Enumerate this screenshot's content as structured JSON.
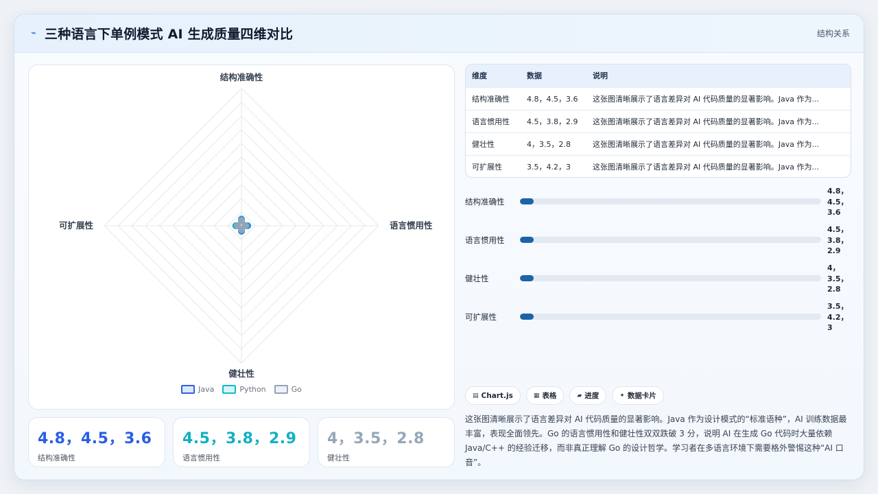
{
  "header": {
    "title": "三种语言下单例模式 AI 生成质量四维对比",
    "icon": "trend-icon",
    "tag": "结构关系"
  },
  "chart_data": {
    "type": "radar",
    "categories": [
      "结构准确性",
      "语言惯用性",
      "健壮性",
      "可扩展性"
    ],
    "series": [
      {
        "name": "Java",
        "values": [
          4.8,
          4.5,
          4.0,
          3.5
        ],
        "color": "#2f62e0"
      },
      {
        "name": "Python",
        "values": [
          4.5,
          3.8,
          3.5,
          4.2
        ],
        "color": "#14b8c8"
      },
      {
        "name": "Go",
        "values": [
          3.6,
          2.9,
          2.8,
          3.0
        ],
        "color": "#94a3b8"
      }
    ],
    "grid_levels": 10,
    "legend_position": "bottom"
  },
  "stats": [
    {
      "value": "4.8，4.5，3.6",
      "label": "结构准确性",
      "color": "#2a5ee6"
    },
    {
      "value": "4.5，3.8，2.9",
      "label": "语言惯用性",
      "color": "#14b0c4"
    },
    {
      "value": "4，3.5，2.8",
      "label": "健壮性",
      "color": "#98a6ba"
    }
  ],
  "table": {
    "headers": [
      "维度",
      "数据",
      "说明"
    ],
    "rows": [
      {
        "dim": "结构准确性",
        "data": "4.8，4.5，3.6",
        "note": "这张图清晰展示了语言差异对 AI 代码质量的显著影响。Java 作为..."
      },
      {
        "dim": "语言惯用性",
        "data": "4.5，3.8，2.9",
        "note": "这张图清晰展示了语言差异对 AI 代码质量的显著影响。Java 作为..."
      },
      {
        "dim": "健壮性",
        "data": "4，3.5，2.8",
        "note": "这张图清晰展示了语言差异对 AI 代码质量的显著影响。Java 作为..."
      },
      {
        "dim": "可扩展性",
        "data": "3.5，4.2，3",
        "note": "这张图清晰展示了语言差异对 AI 代码质量的显著影响。Java 作为..."
      }
    ]
  },
  "progress": [
    {
      "label": "结构准确性",
      "value_lines": [
        "4.8，",
        "4.5，",
        "3.6"
      ],
      "fill": 0.045
    },
    {
      "label": "语言惯用性",
      "value_lines": [
        "4.5，",
        "3.8，",
        "2.9"
      ],
      "fill": 0.045
    },
    {
      "label": "健壮性",
      "value_lines": [
        "4，",
        "3.5，",
        "2.8"
      ],
      "fill": 0.045
    },
    {
      "label": "可扩展性",
      "value_lines": [
        "3.5，",
        "4.2，",
        "3"
      ],
      "fill": 0.045
    }
  ],
  "chips": [
    {
      "icon": "chart-icon",
      "glyph": "▤",
      "label": "Chart.js"
    },
    {
      "icon": "table-icon",
      "glyph": "▦",
      "label": "表格"
    },
    {
      "icon": "progress-icon",
      "glyph": "▰",
      "label": "进度"
    },
    {
      "icon": "sparkle-icon",
      "glyph": "✦",
      "label": "数据卡片"
    }
  ],
  "description": "这张图清晰展示了语言差异对 AI 代码质量的显著影响。Java 作为设计模式的“标准语种”，AI 训练数据最丰富，表现全面领先。Go 的语言惯用性和健壮性双双跌破 3 分，说明 AI 在生成 Go 代码时大量依赖 Java/C++ 的经验迁移，而非真正理解 Go 的设计哲学。学习者在多语言环境下需要格外警惕这种“AI 口音”。"
}
